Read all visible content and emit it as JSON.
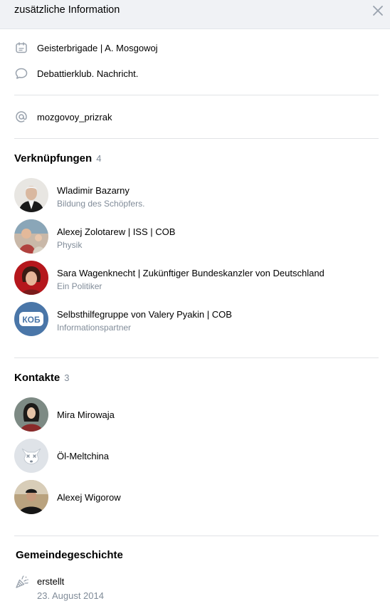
{
  "header": {
    "title": "zusätzliche Information"
  },
  "info": {
    "items": [
      {
        "icon": "calendar-event-icon",
        "text": "Geisterbrigade | A. Mosgowoj"
      },
      {
        "icon": "chat-bubble-icon",
        "text": "Debattierklub. Nachricht."
      }
    ],
    "handle": {
      "icon": "at-sign-icon",
      "text": "mozgovoy_prizrak"
    }
  },
  "links": {
    "title": "Verknüpfungen",
    "count": "4",
    "items": [
      {
        "name": "Wladimir Bazarny",
        "desc": "Bildung des Schöpfers."
      },
      {
        "name": "Alexej Zolotarew | ISS | COB",
        "desc": "Physik"
      },
      {
        "name": "Sara Wagenknecht | Zukünftiger Bundeskanzler von Deutschland",
        "desc": "Ein Politiker"
      },
      {
        "name": "Selbsthilfegruppe von Valery Pyakin | COB",
        "desc": "Informationspartner",
        "avatar_text": "КОБ"
      }
    ]
  },
  "contacts": {
    "title": "Kontakte",
    "count": "3",
    "items": [
      {
        "name": "Mira Mirowaja"
      },
      {
        "name": "Öl-Meltchina"
      },
      {
        "name": "Alexej Wigorow"
      }
    ]
  },
  "history": {
    "title": "Gemeindegeschichte",
    "icon": "party-popper-icon",
    "label": "erstellt",
    "date": "23. August 2014"
  },
  "colors": {
    "accent": "#2a5885",
    "muted": "#818c99",
    "divider": "#e1e3e6",
    "header_bg": "#f0f2f5",
    "icon": "#99a2ad"
  }
}
